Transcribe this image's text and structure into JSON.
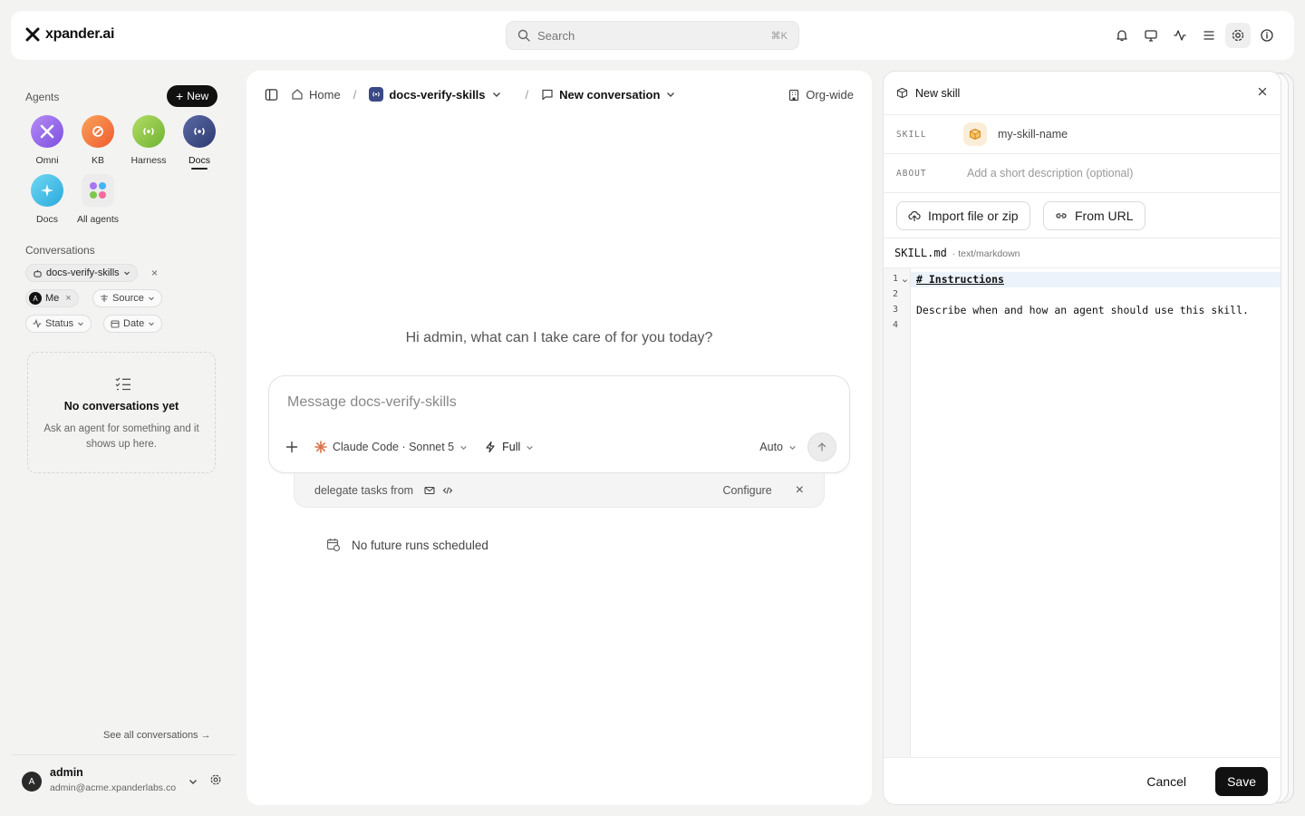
{
  "app": {
    "brand": "xpander.ai",
    "search_placeholder": "Search",
    "search_shortcut": "⌘K"
  },
  "sidebar": {
    "agents_label": "Agents",
    "new_label": "New",
    "agents": [
      {
        "label": "Omni",
        "icon": "omni-icon",
        "color": "#9b6cf0"
      },
      {
        "label": "KB",
        "icon": "kb-icon",
        "color": "#f5773d"
      },
      {
        "label": "Harness",
        "icon": "broadcast-icon",
        "color": "#8cc63f"
      },
      {
        "label": "Docs",
        "icon": "broadcast-icon",
        "color": "#3b4a86"
      },
      {
        "label": "Docs",
        "icon": "sparkle-icon",
        "color": "#3fc2e8"
      },
      {
        "label": "All agents",
        "icon": "grid-icon",
        "color": "#e6e6e6"
      }
    ],
    "conversations_label": "Conversations",
    "filters": {
      "agent_filter": "docs-verify-skills",
      "me_avatar": "A",
      "me_label": "Me",
      "source": "Source",
      "status": "Status",
      "date": "Date"
    },
    "empty": {
      "title": "No conversations yet",
      "description": "Ask an agent for something and it shows up here."
    },
    "see_all": "See all conversations →",
    "user": {
      "avatar": "A",
      "name": "admin",
      "email": "admin@acme.xpanderlabs.co"
    }
  },
  "main": {
    "breadcrumb": {
      "home": "Home",
      "agent": "docs-verify-skills",
      "conversation": "New conversation"
    },
    "scope": "Org-wide",
    "greeting": "Hi admin, what can I take care of for you today?",
    "composer": {
      "placeholder": "Message docs-verify-skills",
      "model": "Claude Code · Sonnet 5",
      "mode": "Full",
      "auto": "Auto"
    },
    "delegate": {
      "text": "delegate tasks from",
      "configure": "Configure"
    },
    "schedule": "No future runs scheduled"
  },
  "skill_panel": {
    "title": "New skill",
    "skill_label": "SKILL",
    "skill_name": "my-skill-name",
    "about_label": "ABOUT",
    "about_placeholder": "Add a short description (optional)",
    "import_label": "Import file or zip",
    "url_label": "From URL",
    "file_name": "SKILL.md",
    "file_type": "· text/markdown",
    "lines": [
      {
        "no": "1",
        "text": "# Instructions"
      },
      {
        "no": "2",
        "text": ""
      },
      {
        "no": "3",
        "text": "Describe when and how an agent should use this skill."
      },
      {
        "no": "4",
        "text": ""
      }
    ],
    "cancel": "Cancel",
    "save": "Save"
  }
}
